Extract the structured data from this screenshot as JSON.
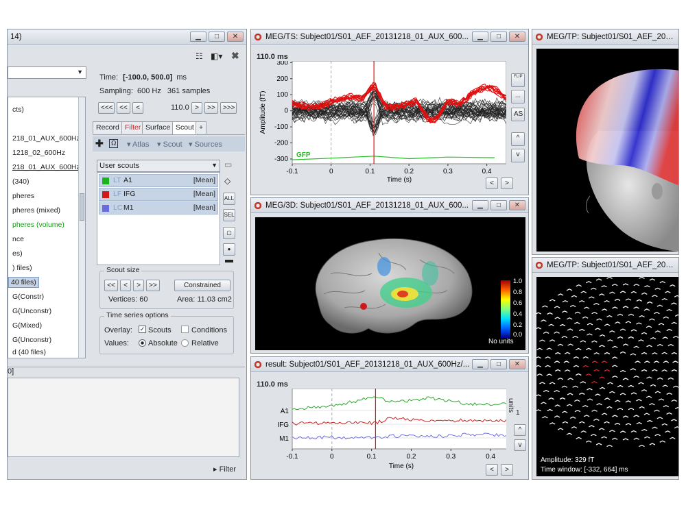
{
  "left_window": {
    "title_fragment": "14)",
    "list_items": [
      "cts)",
      "218_01_AUX_600Hz",
      "1218_02_600Hz",
      "218_01_AUX_600Hz",
      "(340)",
      "pheres",
      "pheres (mixed)",
      "pheres (volume)",
      "nce",
      "es)",
      ") files)",
      "40 files)",
      "G(Constr)",
      "G(Unconstr)",
      "G(Mixed)",
      "G(Unconstr)",
      "d (40 files)"
    ],
    "bottom_label": "0]",
    "filter_label": "Filter"
  },
  "time_panel": {
    "time_label": "Time:",
    "time_value": "[-100.0, 500.0]",
    "time_unit": "ms",
    "sampling_label": "Sampling:",
    "sampling_value": "600 Hz",
    "samples": "361 samples",
    "nav_buttons": [
      "<<<",
      "<<",
      "<",
      ">",
      ">>",
      ">>>"
    ],
    "current_time": "110.0"
  },
  "tabs": [
    "Record",
    "Filter",
    "Surface",
    "Scout",
    "+"
  ],
  "scout_toolbar": {
    "atlas": "Atlas",
    "scout": "Scout",
    "sources": "Sources"
  },
  "scout_select": "User scouts",
  "scouts": [
    {
      "tag": "LT",
      "name": "A1",
      "func": "[Mean]",
      "color": "#19b419"
    },
    {
      "tag": "LF",
      "name": "IFG",
      "func": "[Mean]",
      "color": "#d01818"
    },
    {
      "tag": "LC",
      "name": "M1",
      "func": "[Mean]",
      "color": "#6a6ae0"
    }
  ],
  "scout_side_buttons": [
    "ALL",
    "SEL"
  ],
  "scout_size": {
    "title": "Scout size",
    "buttons": [
      "<<",
      "<",
      ">",
      ">>"
    ],
    "constrained": "Constrained",
    "vertices": "Vertices: 60",
    "area": "Area: 11.03 cm2"
  },
  "ts_options": {
    "title": "Time series options",
    "overlay_label": "Overlay:",
    "scouts": "Scouts",
    "conditions": "Conditions",
    "values_label": "Values:",
    "absolute": "Absolute",
    "relative": "Relative"
  },
  "ts_window": {
    "title": "MEG/TS: Subject01/S01_AEF_20131218_01_AUX_600...",
    "time_readout": "110.0 ms",
    "ylabel": "Amplitude (fT)",
    "xlabel": "Time (s)",
    "yticks": [
      "300",
      "200",
      "100",
      "0",
      "-100",
      "-200",
      "-300"
    ],
    "xticks": [
      "-0.1",
      "0",
      "0.1",
      "0.2",
      "0.3",
      "0.4"
    ],
    "gfp": "GFP",
    "side_buttons": [
      "FLIP",
      "...",
      "AS",
      "^",
      "v"
    ]
  },
  "view3d_window": {
    "title": "MEG/3D: Subject01/S01_AEF_20131218_01_AUX_600...",
    "colorbar_ticks": [
      "1.0",
      "0.8",
      "0.6",
      "0.4",
      "0.2",
      "0.0"
    ],
    "colorbar_units": "No units"
  },
  "result_window": {
    "title": "result: Subject01/S01_AEF_20131218_01_AUX_600Hz/...",
    "time_readout": "110.0 ms",
    "row_labels": [
      "A1",
      "IFG",
      "M1"
    ],
    "xticks": [
      "-0.1",
      "0",
      "0.1",
      "0.2",
      "0.3",
      "0.4"
    ],
    "xlabel": "Time (s)",
    "units_label": "units",
    "scale_label": "1"
  },
  "tp_window1": {
    "title": "MEG/TP: Subject01/S01_AEF_2013121"
  },
  "tp_window2": {
    "title": "MEG/TP: Subject01/S01_AEF_2013121",
    "amplitude": "Amplitude:     329 fT",
    "time_window": "Time window: [-332, 664] ms"
  },
  "chart_data": [
    {
      "type": "line",
      "title": "MEG/TS",
      "xlabel": "Time (s)",
      "ylabel": "Amplitude (fT)",
      "xlim": [
        -0.1,
        0.45
      ],
      "ylim": [
        -330,
        310
      ],
      "cursor_x": 0.11,
      "series": [
        {
          "name": "GFP",
          "x": [
            -0.1,
            0.0,
            0.11,
            0.2,
            0.3,
            0.42
          ],
          "values": [
            -305,
            -295,
            -282,
            -298,
            -288,
            -292
          ]
        }
      ]
    },
    {
      "type": "line",
      "title": "result",
      "xlabel": "Time (s)",
      "xlim": [
        -0.1,
        0.45
      ],
      "cursor_x": 0.11,
      "series": [
        {
          "name": "A1",
          "x": [
            -0.1,
            0.0,
            0.11,
            0.15,
            0.25,
            0.35,
            0.45
          ],
          "values": [
            0.3,
            0.6,
            2.0,
            1.2,
            1.8,
            0.9,
            1.0
          ]
        },
        {
          "name": "IFG",
          "x": [
            -0.1,
            0.0,
            0.11,
            0.15,
            0.25,
            0.35,
            0.45
          ],
          "values": [
            0.1,
            0.2,
            0.2,
            0.9,
            0.4,
            0.6,
            0.5
          ]
        },
        {
          "name": "M1",
          "x": [
            -0.1,
            0.0,
            0.11,
            0.15,
            0.25,
            0.35,
            0.45
          ],
          "values": [
            0.0,
            0.1,
            0.0,
            0.3,
            0.2,
            0.5,
            0.4
          ]
        }
      ]
    }
  ]
}
